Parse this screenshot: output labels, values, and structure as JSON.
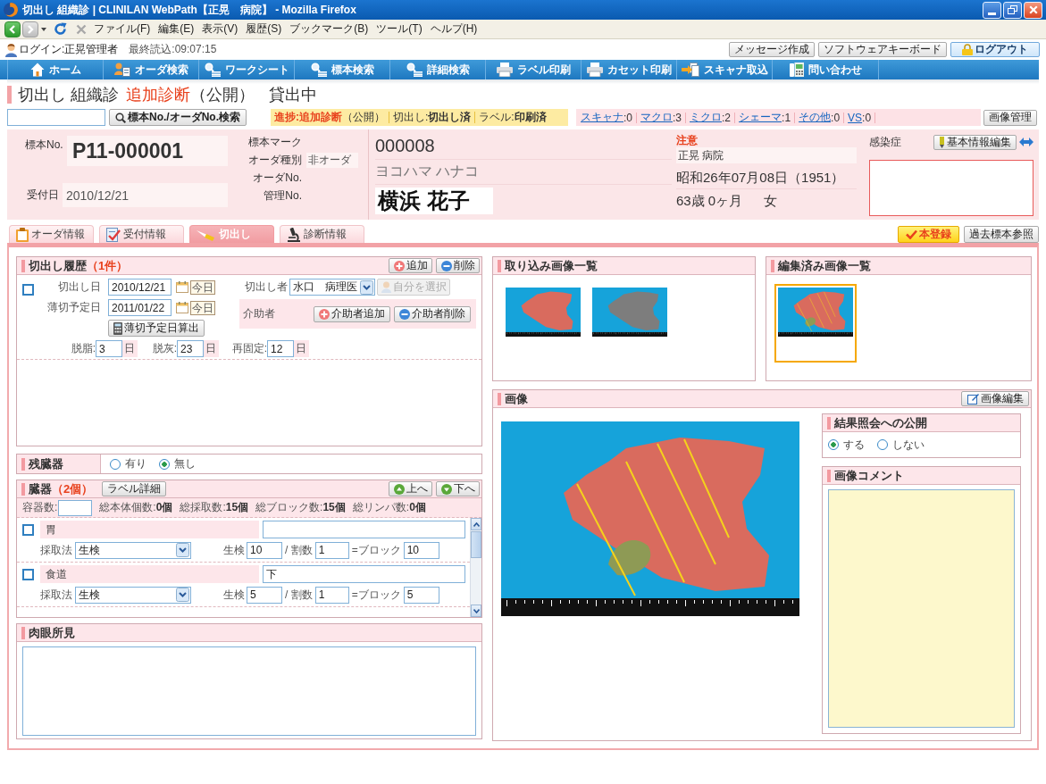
{
  "window": {
    "title": "切出し 組織診 | CLINILAN WebPath【正晃　病院】 - Mozilla Firefox"
  },
  "browser_menu": [
    "ファイル(F)",
    "編集(E)",
    "表示(V)",
    "履歴(S)",
    "ブックマーク(B)",
    "ツール(T)",
    "ヘルプ(H)"
  ],
  "session": {
    "login": "ログイン:正晃管理者",
    "last_loaded": "最終読込:09:07:15",
    "buttons": [
      {
        "label": "メッセージ作成",
        "kind": "plain"
      },
      {
        "label": "ソフトウェアキーボード",
        "kind": "plain"
      },
      {
        "label": "ログアウト",
        "kind": "logout"
      }
    ]
  },
  "nav": [
    {
      "label": "ホーム",
      "kind": "home"
    },
    {
      "label": "オーダ検索",
      "kind": "order"
    },
    {
      "label": "ワークシート",
      "kind": "search"
    },
    {
      "label": "標本検索",
      "kind": "search"
    },
    {
      "label": "詳細検索",
      "kind": "search"
    },
    {
      "label": "ラベル印刷",
      "kind": "print"
    },
    {
      "label": "カセット印刷",
      "kind": "print"
    },
    {
      "label": "スキャナ取込",
      "kind": "scan"
    },
    {
      "label": "問い合わせ",
      "kind": "inquiry"
    }
  ],
  "page_title": {
    "screen": "切出し 組織診",
    "status": "追加診断",
    "publication": "（公開）",
    "loan": "貸出中"
  },
  "search": {
    "button": "標本No./オーダNo.検索"
  },
  "progress": [
    {
      "kind": "progress",
      "text": "**進捗:追加診断**（公開）"
    },
    {
      "kind": "step",
      "text": "切出し:**切出し済**"
    },
    {
      "kind": "step",
      "text": "ラベル:**印刷済**"
    }
  ],
  "image_counts": [
    {
      "label": "スキャナ",
      "count": ":0"
    },
    {
      "label": "マクロ",
      "count": ":3"
    },
    {
      "label": "ミクロ",
      "count": ":2"
    },
    {
      "label": "シェーマ",
      "count": ":1"
    },
    {
      "label": "その他",
      "count": ":0"
    },
    {
      "label": "VS",
      "count": ":0"
    }
  ],
  "image_manage_button": "画像管理",
  "specimen": {
    "no_label": "標本No.",
    "no": "P11-000001",
    "received_label": "受付日",
    "received": "2010/12/21",
    "fields": [
      {
        "label": "標本マーク"
      },
      {
        "label": "オーダ種別",
        "value": "非オーダ"
      },
      {
        "label": "オーダNo."
      },
      {
        "label": "管理No."
      }
    ]
  },
  "patient": {
    "id": "000008",
    "kana": "ヨコハマ ハナコ",
    "name": "横浜 花子"
  },
  "caution": {
    "label": "注意",
    "hospital": "正晃 病院",
    "birth": "昭和26年07月08日（1951）",
    "age": "63歳 0ヶ月",
    "sex": "女"
  },
  "infection": {
    "label": "感染症",
    "edit_button": "基本情報編集"
  },
  "tabs": [
    {
      "label": "オーダ情報",
      "kind": "order",
      "selected": false
    },
    {
      "label": "受付情報",
      "kind": "reception",
      "selected": false
    },
    {
      "label": "切出し",
      "kind": "cutting",
      "selected": true
    },
    {
      "label": "診断情報",
      "kind": "diagnosis",
      "selected": false
    }
  ],
  "actions": [
    {
      "label": "本登録",
      "kind": "primary"
    },
    {
      "label": "過去標本参照",
      "kind": "plain"
    }
  ],
  "cutting_history": {
    "title": "切出し履歴",
    "count": "（1件）",
    "buttons": [
      {
        "label": "追加",
        "kind": "add"
      },
      {
        "label": "削除",
        "kind": "remove"
      }
    ],
    "entries": [
      {
        "checked": false,
        "dates": [
          {
            "label": "切出し日",
            "value": "2010/12/21",
            "today": "今日"
          },
          {
            "label": "薄切予定日",
            "value": "2011/01/22",
            "today": "今日"
          }
        ],
        "calc_button": "薄切予定日算出",
        "cutter_label": "切出し者",
        "cutter": "水口　病理医",
        "self_select": {
          "label": "自分を選択",
          "disabled": true
        },
        "assistant_label": "介助者",
        "assistant_buttons": [
          {
            "label": "介助者追加",
            "kind": "add"
          },
          {
            "label": "介助者削除",
            "kind": "remove"
          }
        ],
        "days": [
          {
            "label": "脱脂:",
            "value": "3",
            "unit": "日"
          },
          {
            "label": "脱灰:",
            "value": "23",
            "unit": "日"
          },
          {
            "label": "再固定:",
            "value": "12",
            "unit": "日"
          }
        ]
      }
    ]
  },
  "remaining_organs": {
    "title": "残臓器",
    "options": [
      {
        "label": "有り",
        "selected": false
      },
      {
        "label": "無し",
        "selected": true
      }
    ]
  },
  "organs": {
    "title": "臓器",
    "count": "（2個）",
    "label_button": "ラベル詳細",
    "buttons": [
      {
        "label": "上へ",
        "kind": "up"
      },
      {
        "label": "下へ",
        "kind": "down"
      }
    ],
    "container_label": "容器数:",
    "totals": [
      "総本体個数:**0個**",
      "総採取数:**15個**",
      "総ブロック数:**15個**",
      "総リンパ数:**0個**"
    ],
    "items": [
      {
        "checked": false,
        "name": "胃",
        "method_label": "採取法",
        "method": "生検",
        "biopsy_label": "生検",
        "biopsy": "10",
        "split_label": "/ 割数",
        "split": "1",
        "block_label": "=ブロック",
        "block": "10"
      },
      {
        "checked": false,
        "name": "食道",
        "note": "下",
        "method_label": "採取法",
        "method": "生検",
        "biopsy_label": "生検",
        "biopsy": "5",
        "split_label": "/ 割数",
        "split": "1",
        "block_label": "=ブロック",
        "block": "5"
      }
    ]
  },
  "gross_findings": {
    "title": "肉眼所見"
  },
  "imported_images": {
    "title": "取り込み画像一覧",
    "thumbnails": [
      {
        "kind": "color",
        "selected": false
      },
      {
        "kind": "monochrome",
        "selected": false
      }
    ]
  },
  "edited_images": {
    "title": "編集済み画像一覧",
    "thumbnails": [
      {
        "kind": "annotated",
        "selected": true
      }
    ]
  },
  "image_view": {
    "title": "画像",
    "edit_button": "画像編集",
    "publish": {
      "title": "結果照会への公開",
      "options": [
        {
          "label": "する",
          "selected": true
        },
        {
          "label": "しない",
          "selected": false
        }
      ]
    },
    "comment": {
      "title": "画像コメント"
    }
  }
}
